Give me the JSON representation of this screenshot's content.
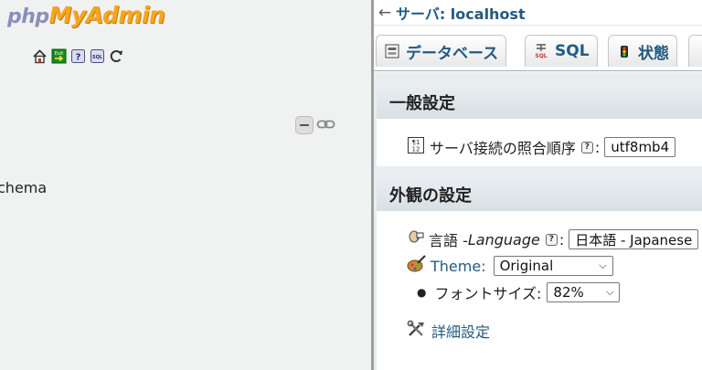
{
  "logo": {
    "part1": "php",
    "part2": "MyAdmin"
  },
  "nav": {
    "icons": [
      "home-icon",
      "exit-icon",
      "docs-icon",
      "sql-docs-icon",
      "reload-icon"
    ],
    "tree_item": "chema"
  },
  "header": {
    "back_arrow": "←",
    "server_label": "サーバ: localhost"
  },
  "tabs": [
    {
      "label": "データベース",
      "icon": "database-icon"
    },
    {
      "label": "SQL",
      "icon": "sql-icon"
    },
    {
      "label": "状態",
      "icon": "status-icon"
    }
  ],
  "general": {
    "title": "一般設定",
    "collation_label": "サーバ接続の照合順序",
    "collation_value": "utf8mb4"
  },
  "appearance": {
    "title": "外観の設定",
    "language_label": "言語 - ",
    "language_en": "Language",
    "language_value": "日本語 - Japanese",
    "theme_label": "Theme:",
    "theme_value": "Original",
    "fontsize_label": "フォントサイズ:",
    "fontsize_value": "82%",
    "more_settings": "詳細設定"
  },
  "colors": {
    "link": "#235a81",
    "nav_bg": "#f0f2f2",
    "logo_orange": "#f7a521"
  }
}
